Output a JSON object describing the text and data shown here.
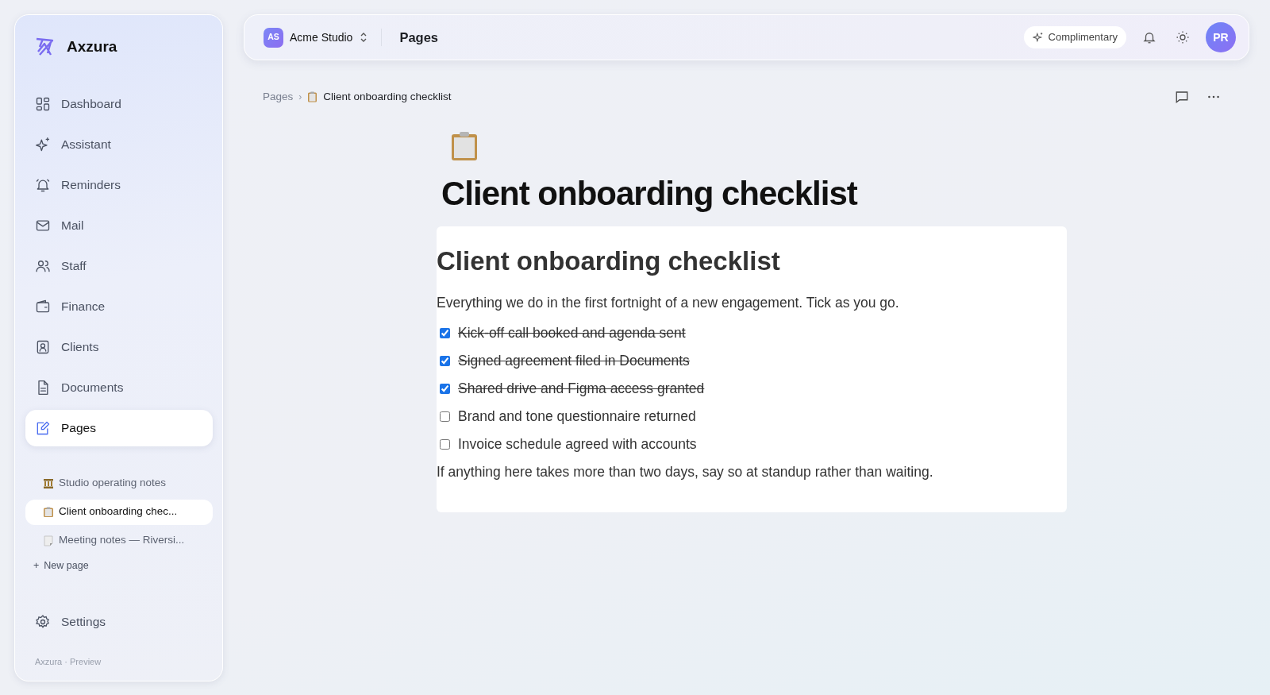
{
  "sidebar": {
    "brand": "Axzura",
    "nav": [
      {
        "label": "Dashboard",
        "selected": false
      },
      {
        "label": "Assistant",
        "selected": false
      },
      {
        "label": "Reminders",
        "selected": false
      },
      {
        "label": "Mail",
        "selected": false
      },
      {
        "label": "Staff",
        "selected": false
      },
      {
        "label": "Finance",
        "selected": false
      },
      {
        "label": "Clients",
        "selected": false
      },
      {
        "label": "Documents",
        "selected": false
      },
      {
        "label": "Pages",
        "selected": true
      }
    ],
    "pages": [
      {
        "label": "Studio operating notes",
        "selected": false
      },
      {
        "label": "Client onboarding chec...",
        "selected": true
      },
      {
        "label": "Meeting notes — Riversi...",
        "selected": false
      }
    ],
    "new_page": {
      "icon": "+",
      "label": "New page"
    },
    "settings": "Settings",
    "footer": "Axzura · Preview"
  },
  "topbar": {
    "workspace_initials": "AS",
    "workspace": "Acme Studio",
    "title": "Pages",
    "plan": "Complimentary",
    "avatar": "PR"
  },
  "breadcrumb": {
    "parent": "Pages",
    "separator": "›",
    "current": "Client onboarding checklist"
  },
  "page": {
    "title": "Client onboarding checklist",
    "heading": "Client onboarding checklist",
    "intro": "Everything we do in the first fortnight of a new engagement. Tick as you go.",
    "checklist": [
      {
        "label": "Kick-off call booked and agenda sent",
        "checked": true
      },
      {
        "label": "Signed agreement filed in Documents",
        "checked": true
      },
      {
        "label": "Shared drive and Figma access granted",
        "checked": true
      },
      {
        "label": "Brand and tone questionnaire returned",
        "checked": false
      },
      {
        "label": "Invoice schedule agreed with accounts",
        "checked": false
      }
    ],
    "outro": "If anything here takes more than two days, say so at standup rather than waiting."
  }
}
